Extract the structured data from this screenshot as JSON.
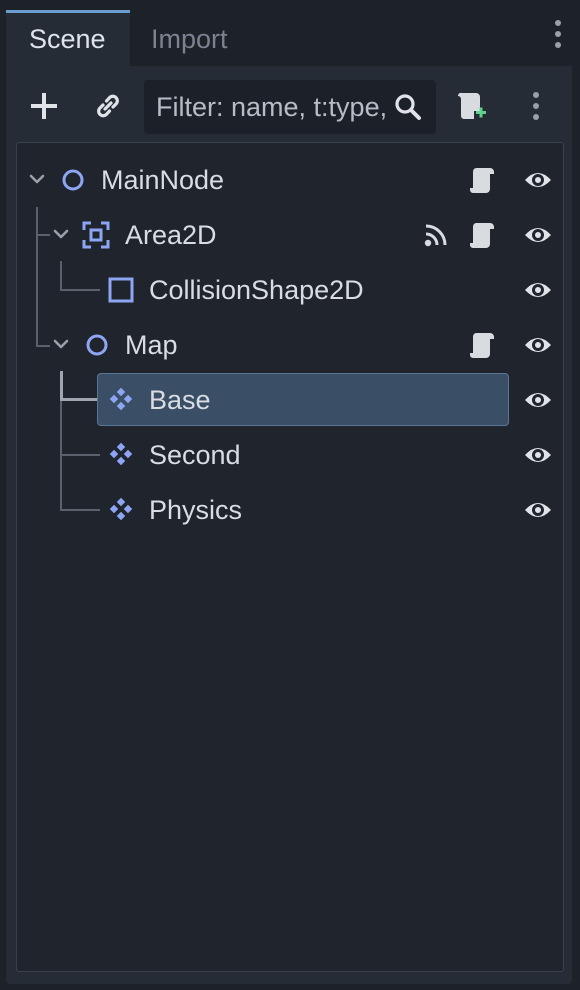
{
  "tabs": [
    {
      "label": "Scene",
      "active": true
    },
    {
      "label": "Import",
      "active": false
    }
  ],
  "toolbar": {
    "filter_placeholder": "Filter: name, t:type, g:group"
  },
  "tree": [
    {
      "label": "MainNode",
      "icon": "node-circle-icon",
      "expanded": true,
      "has_script": true,
      "has_signal": false,
      "visible": true
    },
    {
      "label": "Area2D",
      "icon": "area2d-icon",
      "expanded": true,
      "has_script": true,
      "has_signal": true,
      "visible": true
    },
    {
      "label": "CollisionShape2D",
      "icon": "collision-shape-icon",
      "has_script": false,
      "has_signal": false,
      "visible": true
    },
    {
      "label": "Map",
      "icon": "node-circle-icon",
      "expanded": true,
      "has_script": true,
      "has_signal": false,
      "visible": true
    },
    {
      "label": "Base",
      "icon": "tilemap-icon",
      "selected": true,
      "has_script": false,
      "visible": true
    },
    {
      "label": "Second",
      "icon": "tilemap-icon",
      "has_script": false,
      "visible": true
    },
    {
      "label": "Physics",
      "icon": "tilemap-icon",
      "has_script": false,
      "visible": true
    }
  ],
  "colors": {
    "accent": "#6a9ccf",
    "node_icon": "#8da5f3",
    "selection": "#3a4e66",
    "script_add": "#5fd38d"
  }
}
